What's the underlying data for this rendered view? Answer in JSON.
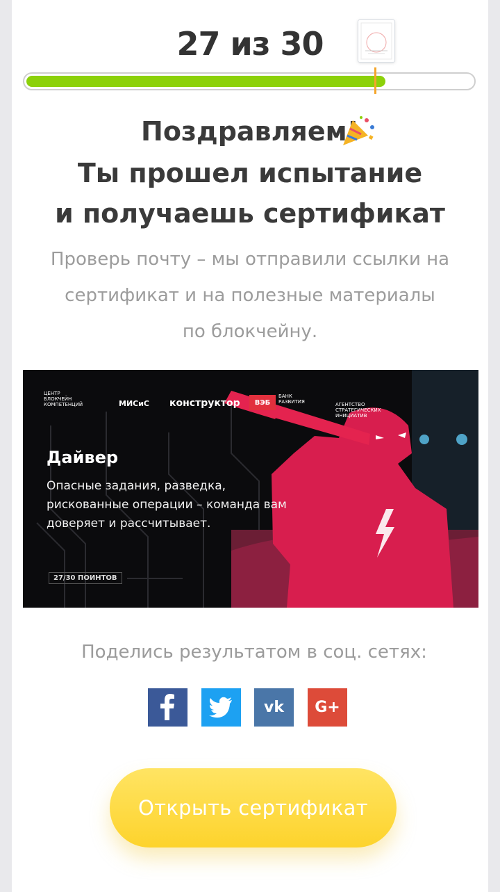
{
  "progress": {
    "score_text": "27 из 30",
    "current": 27,
    "total": 30,
    "fill_color": "#8cd10a",
    "marker_color": "#f4a52a"
  },
  "certificate_thumb": {
    "label": "СЕРТИФИКАТ"
  },
  "heading": {
    "line1": "Поздравляем!",
    "line2": "Ты прошел испытание",
    "line3": "и получаешь сертификат",
    "emoji_icon": "party-popper-icon"
  },
  "description": {
    "line1": "Проверь почту – мы отправили ссылки на",
    "line2": "сертификат и на полезные материалы",
    "line3": "по блокчейну."
  },
  "banner": {
    "logos": {
      "center_line1": "ЦЕНТР",
      "center_line2": "БЛОКЧЕЙН",
      "center_line3": "КОМПЕТЕНЦИЙ",
      "misis": "МИСиС",
      "konstruktor": "конструктор",
      "veb": "ВЭБ",
      "bank_line1": "БАНК",
      "bank_line2": "РАЗВИТИЯ",
      "asi_line1": "АГЕНТСТВО",
      "asi_line2": "СТРАТЕГИЧЕСКИХ",
      "asi_line3": "ИНИЦИАТИВ"
    },
    "title": "Дайвер",
    "text": "Опасные задания, разведка, рискованные операции – команда вам доверяет и рассчитывает.",
    "points": "27/30 ПОИНТОВ"
  },
  "share": {
    "label": "Поделись результатом в соц. сетях:",
    "buttons": [
      {
        "name": "facebook",
        "glyph": "f",
        "color": "#3b5998"
      },
      {
        "name": "twitter",
        "glyph": "t",
        "color": "#1da1f2"
      },
      {
        "name": "vk",
        "glyph": "vk",
        "color": "#4a76a8"
      },
      {
        "name": "google-plus",
        "glyph": "G+",
        "color": "#dd4b39"
      }
    ]
  },
  "cta": {
    "label": "Открыть сертификат",
    "color": "#fdd32c"
  }
}
